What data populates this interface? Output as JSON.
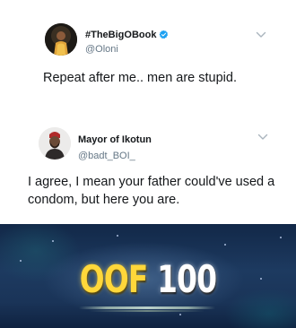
{
  "tweets": [
    {
      "display_name": "#TheBigOBook",
      "handle": "@Oloni",
      "verified": true,
      "text": "Repeat after me.. men are stupid."
    },
    {
      "display_name": "Mayor of Ikotun",
      "handle": "@badt_BOI_",
      "verified": false,
      "text": "I agree, I mean your father could've used a condom, but here you are."
    }
  ],
  "banner": {
    "word": "OOF",
    "score": "100"
  },
  "colors": {
    "verified_blue": "#1da1f2",
    "text": "#14171a",
    "secondary": "#657786",
    "oof_gold": "#ffd73a"
  }
}
